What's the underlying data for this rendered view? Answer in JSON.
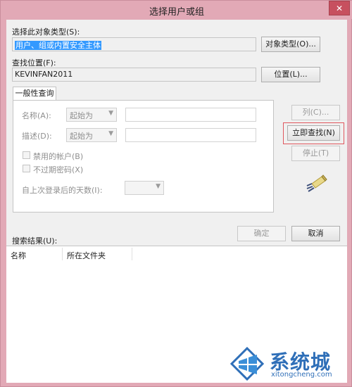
{
  "window": {
    "title": "选择用户或组",
    "close_glyph": "✕"
  },
  "object_type": {
    "label": "选择此对象类型(S):",
    "value": "用户、组或内置安全主体",
    "button": "对象类型(O)..."
  },
  "location": {
    "label": "查找位置(F):",
    "value": "KEVINFAN2011",
    "button": "位置(L)..."
  },
  "tabs": [
    {
      "label": "一般性查询"
    }
  ],
  "query": {
    "name_label": "名称(A):",
    "name_mode": "起始为",
    "desc_label": "描述(D):",
    "desc_mode": "起始为",
    "disabled_accounts": "禁用的帐户(B)",
    "no_expire_password": "不过期密码(X)",
    "days_since_logon": "自上次登录后的天数(I):"
  },
  "side_buttons": {
    "columns": "列(C)...",
    "find_now": "立即查找(N)",
    "stop": "停止(T)"
  },
  "actions": {
    "ok": "确定",
    "cancel": "取消"
  },
  "results": {
    "label": "搜索结果(U):",
    "columns": [
      "名称",
      "所在文件夹"
    ]
  },
  "watermark": {
    "text": "系统城",
    "url": "xitongcheng.com"
  },
  "colors": {
    "title_bar": "#e2a9b6",
    "highlight_box": "#e0565e",
    "selection": "#3399ff",
    "watermark": "#2f6fb8"
  },
  "icons": {
    "search_flashlight": "flashlight-icon",
    "dropdown": "chevron-down-icon"
  }
}
